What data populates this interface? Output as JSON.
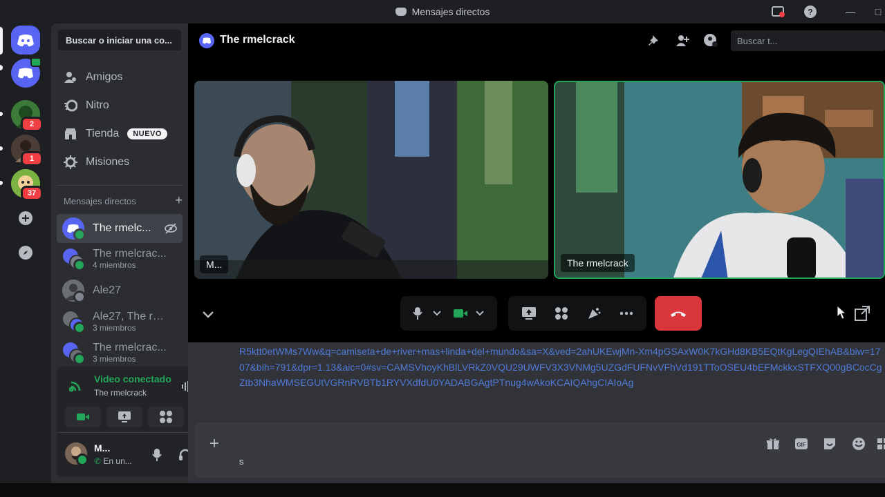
{
  "window": {
    "title": "Mensajes directos"
  },
  "servers": {
    "badges": [
      "2",
      "1",
      "37"
    ]
  },
  "sidebar": {
    "search_placeholder": "Buscar o iniciar una co...",
    "nav": [
      {
        "label": "Amigos",
        "icon": "friends-icon"
      },
      {
        "label": "Nitro",
        "icon": "nitro-icon"
      },
      {
        "label": "Tienda",
        "icon": "shop-icon",
        "tag": "NUEVO"
      },
      {
        "label": "Misiones",
        "icon": "quests-icon"
      }
    ],
    "dm_header": "Mensajes directos",
    "dms": [
      {
        "name": "The rmelc...",
        "sub": ""
      },
      {
        "name": "The rmelcrac...",
        "sub": "4 miembros"
      },
      {
        "name": "Ale27",
        "sub": ""
      },
      {
        "name": "Ale27, The rm...",
        "sub": "3 miembros"
      },
      {
        "name": "The rmelcrac...",
        "sub": "3 miembros"
      }
    ]
  },
  "voice": {
    "status": "Video conectado",
    "channel": "The rmelcrack"
  },
  "user": {
    "name": "M...",
    "status": "En un..."
  },
  "main": {
    "title": "The rmelcrack",
    "search_placeholder": "Buscar t...",
    "tiles": [
      {
        "label": "M..."
      },
      {
        "label": "The rmelcrack"
      }
    ],
    "message_link": "R5ktt0etWMs7Ww&q=camiseta+de+river+mas+linda+del+mundo&sa=X&ved=2ahUKEwjMn-Xm4pGSAxW0K7kGHd8KB5EQtKgLegQIEhAB&biw=1707&bih=791&dpr=1.13&aic=0#sv=CAMSVhoyKhBlLVRkZ0VQU29UWFV3X3VNMg5UZGdFUFNvVFhVd191TToOSEU4bEFMckkxSTFXQ00gBCocCgZtb3NhaWMSEGUtVGRnRVBTb1RYVXdfdU0YADABGAgtPTnug4wAkoKCAIQAhgCIAIoAg",
    "composer_text": "s"
  },
  "colors": {
    "accent": "#5865f2",
    "online": "#23a55a",
    "danger": "#da373c",
    "link": "#4f7ad8"
  }
}
